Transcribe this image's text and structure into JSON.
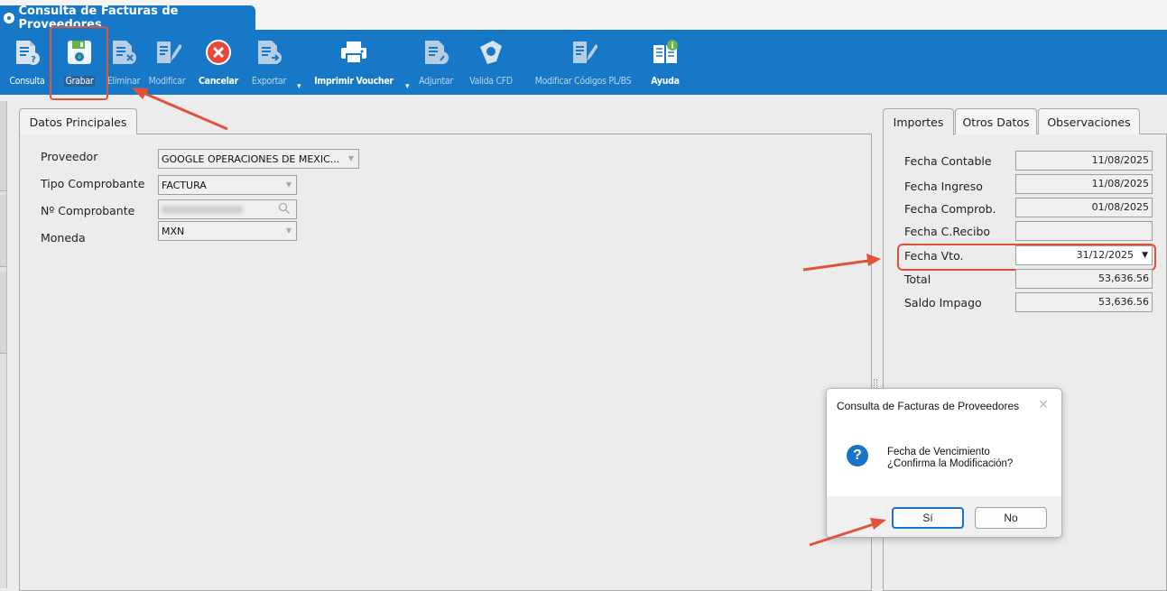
{
  "window": {
    "title": "Consulta de Facturas de Proveedores"
  },
  "toolbar": {
    "items": [
      {
        "label": "Consulta",
        "icon": "document-question-icon",
        "state": "normal"
      },
      {
        "label": "Grabar",
        "icon": "save-floppy-icon",
        "state": "active"
      },
      {
        "label": "Eliminar",
        "icon": "document-delete-icon",
        "state": "disabled"
      },
      {
        "label": "Modificar",
        "icon": "document-edit-icon",
        "state": "disabled"
      },
      {
        "label": "Cancelar",
        "icon": "cancel-circle-icon",
        "state": "bold"
      },
      {
        "label": "Exportar",
        "icon": "document-export-icon",
        "state": "disabled"
      },
      {
        "label": "Imprimir Voucher",
        "icon": "printer-icon",
        "state": "bold"
      },
      {
        "label": "Adjuntar",
        "icon": "document-attach-icon",
        "state": "disabled"
      },
      {
        "label": "Valida CFD",
        "icon": "validate-cfd-icon",
        "state": "disabled"
      },
      {
        "label": "Modificar Códigos PL/BS",
        "icon": "document-edit-codes-icon",
        "state": "disabled"
      },
      {
        "label": "Ayuda",
        "icon": "help-book-icon",
        "state": "bold"
      }
    ]
  },
  "main": {
    "tab": "Datos Principales",
    "fields": {
      "proveedor": {
        "label": "Proveedor",
        "value": "GOOGLE OPERACIONES DE MEXIC..."
      },
      "tipo": {
        "label": "Tipo Comprobante",
        "value": "FACTURA"
      },
      "numero": {
        "label": "Nº Comprobante",
        "value": ""
      },
      "moneda": {
        "label": "Moneda",
        "value": "MXN"
      }
    }
  },
  "right": {
    "tabs": [
      "Importes",
      "Otros Datos",
      "Observaciones"
    ],
    "rows": [
      {
        "label": "Fecha Contable",
        "value": "11/08/2025"
      },
      {
        "label": "Fecha Ingreso",
        "value": "11/08/2025"
      },
      {
        "label": "Fecha Comprob.",
        "value": "01/08/2025"
      },
      {
        "label": "Fecha C.Recibo",
        "value": ""
      },
      {
        "label": "Fecha Vto.",
        "value": "31/12/2025"
      },
      {
        "label": "Total",
        "value": "53,636.56"
      },
      {
        "label": "Saldo Impago",
        "value": "53,636.56"
      }
    ]
  },
  "dialog": {
    "title": "Consulta de Facturas de Proveedores",
    "line1": "Fecha de Vencimiento",
    "line2": "¿Confirma la Modificación?",
    "yes": "Sí",
    "no": "No"
  },
  "colors": {
    "toolbar": "#1878c8",
    "annotation": "#e0533b",
    "dialog_accent": "#1a73c9"
  }
}
